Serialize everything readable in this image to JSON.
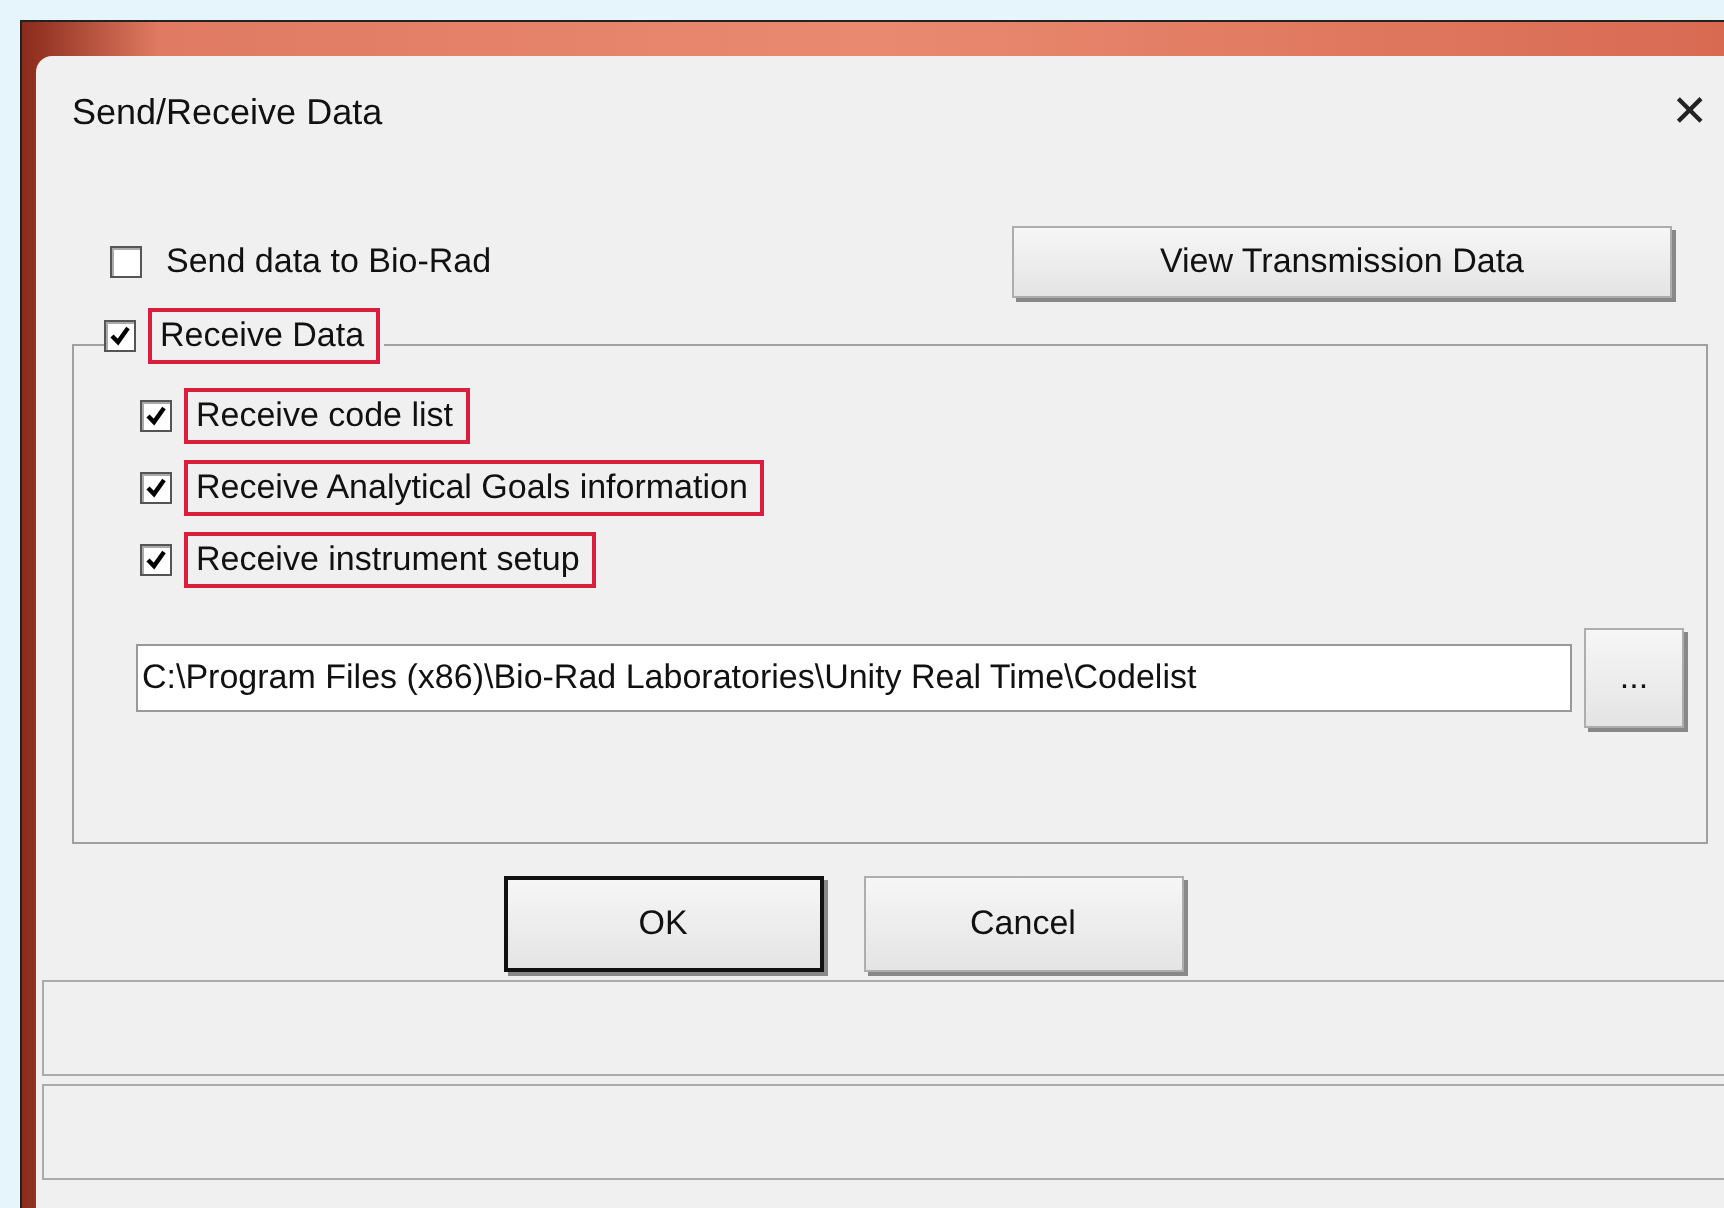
{
  "window": {
    "title": "Send/Receive Data",
    "close": "✕"
  },
  "send_option": {
    "label": "Send data to Bio-Rad",
    "checked": false,
    "highlighted": false
  },
  "view_button": "View Transmission Data",
  "receive_group": {
    "label": "Receive Data",
    "checked": true,
    "highlighted": true,
    "options": [
      {
        "label": "Receive code list",
        "checked": true,
        "highlighted": true
      },
      {
        "label": "Receive Analytical Goals information",
        "checked": true,
        "highlighted": true
      },
      {
        "label": "Receive instrument setup",
        "checked": true,
        "highlighted": true
      }
    ],
    "path": "C:\\Program Files (x86)\\Bio-Rad Laboratories\\Unity Real Time\\Codelist",
    "browse_button": "..."
  },
  "buttons": [
    {
      "label": "OK",
      "default": true
    },
    {
      "label": "Cancel",
      "default": false
    }
  ]
}
